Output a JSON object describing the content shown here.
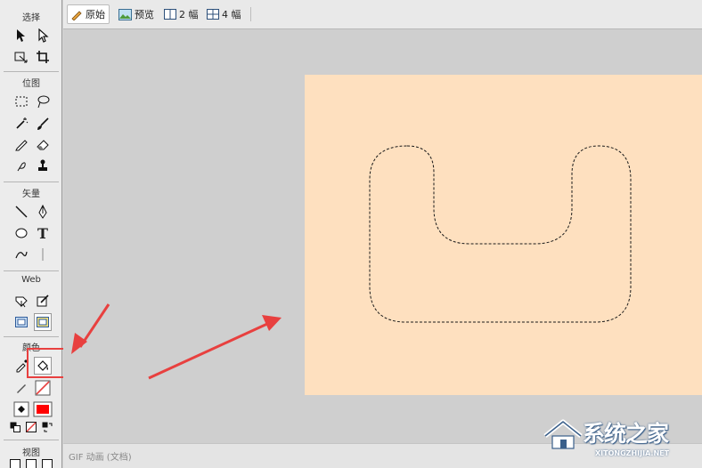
{
  "toolbox": {
    "sections": {
      "select": "选择",
      "bitmap": "位图",
      "vector": "矢量",
      "web": "Web",
      "colors": "颜色",
      "view": "视图"
    },
    "text_tool_glyph": "T"
  },
  "tabs": [
    {
      "label": "原始",
      "icon": "pencil-icon",
      "active": true
    },
    {
      "label": "预览",
      "icon": "image-icon",
      "active": false
    },
    {
      "label": "2 幅",
      "icon": "two-up-icon",
      "active": false
    },
    {
      "label": "4 幅",
      "icon": "four-up-icon",
      "active": false
    }
  ],
  "status": {
    "text": "GIF 动画 (文档)"
  },
  "colors": {
    "canvas": "#fee0bf",
    "workspace": "#cfcfcf",
    "annotation": "#e8403f",
    "fill_swatch": "#ff0000"
  },
  "watermark": {
    "brand": "系统之家",
    "url": "XITONGZHIJIA.NET"
  }
}
